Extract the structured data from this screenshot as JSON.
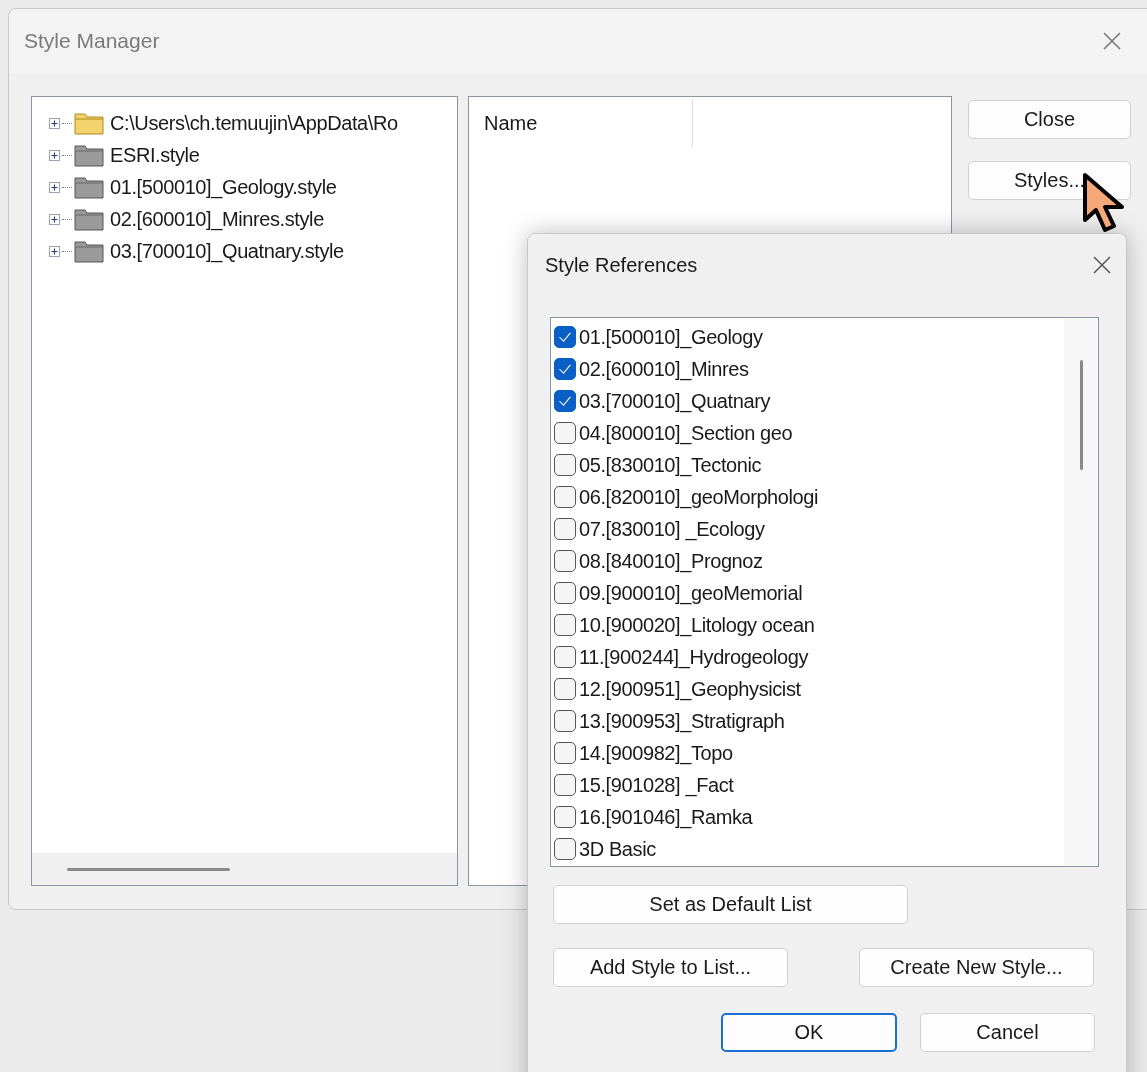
{
  "window": {
    "title": "Style Manager"
  },
  "tree": {
    "items": [
      {
        "label": "C:\\Users\\ch.temuujin\\AppData\\Ro",
        "kind": "directory",
        "expanded": false
      },
      {
        "label": "ESRI.style",
        "kind": "style",
        "expanded": false
      },
      {
        "label": "01.[500010]_Geology.style",
        "kind": "style",
        "expanded": false
      },
      {
        "label": "02.[600010]_Minres.style",
        "kind": "style",
        "expanded": false
      },
      {
        "label": "03.[700010]_Quatnary.style",
        "kind": "style",
        "expanded": false
      }
    ]
  },
  "contents": {
    "columns": [
      "Name"
    ]
  },
  "buttons": [
    "Close",
    "Styles..."
  ],
  "style_references": {
    "title": "Style References",
    "items": [
      {
        "label": "01.[500010]_Geology",
        "checked": true
      },
      {
        "label": "02.[600010]_Minres",
        "checked": true
      },
      {
        "label": "03.[700010]_Quatnary",
        "checked": true
      },
      {
        "label": "04.[800010]_Section geo",
        "checked": false
      },
      {
        "label": "05.[830010]_Tectonic",
        "checked": false
      },
      {
        "label": "06.[820010]_geoMorphologi",
        "checked": false
      },
      {
        "label": "07.[830010] _Ecology",
        "checked": false
      },
      {
        "label": "08.[840010]_Prognoz",
        "checked": false
      },
      {
        "label": "09.[900010]_geoMemorial",
        "checked": false
      },
      {
        "label": "10.[900020]_Litology ocean",
        "checked": false
      },
      {
        "label": "11.[900244]_Hydrogeology",
        "checked": false
      },
      {
        "label": "12.[900951]_Geophysicist",
        "checked": false
      },
      {
        "label": "13.[900953]_Stratigraph",
        "checked": false
      },
      {
        "label": "14.[900982]_Topo",
        "checked": false
      },
      {
        "label": "15.[901028] _Fact",
        "checked": false
      },
      {
        "label": "16.[901046]_Ramka",
        "checked": false
      },
      {
        "label": "3D Basic",
        "checked": false
      }
    ],
    "default_button": "Set as Default List",
    "add_button": "Add Style to List...",
    "create_button": "Create New Style...",
    "ok_button": "OK",
    "cancel_button": "Cancel"
  }
}
